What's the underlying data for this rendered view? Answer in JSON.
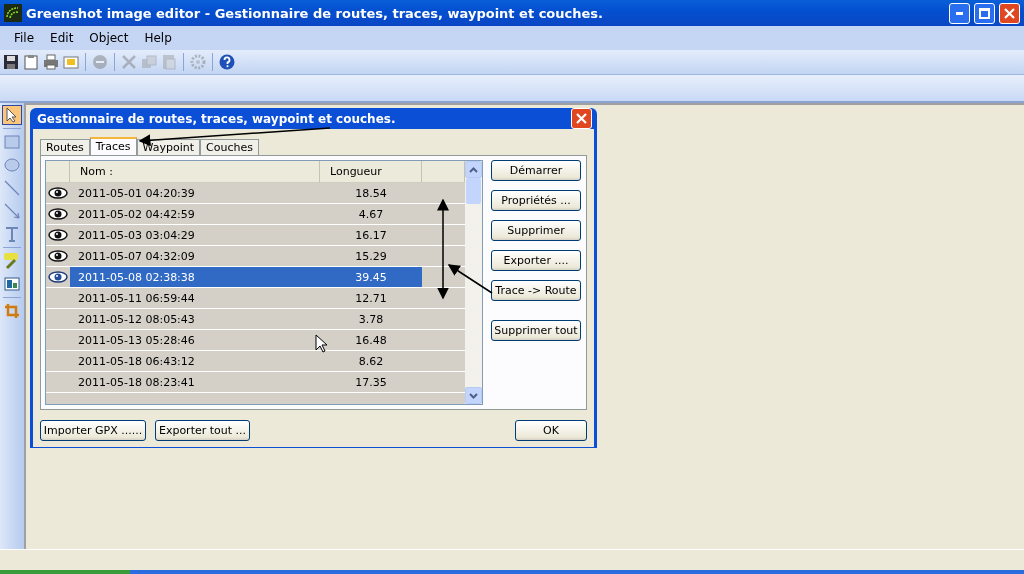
{
  "window": {
    "title": "Greenshot image editor - Gestionnaire de routes, traces, waypoint et couches."
  },
  "menu": [
    "File",
    "Edit",
    "Object",
    "Help"
  ],
  "toolbar": [
    [
      {
        "kind": "save",
        "disabled": false
      },
      {
        "kind": "clipboard",
        "disabled": false
      },
      {
        "kind": "print",
        "disabled": false
      },
      {
        "kind": "email",
        "disabled": false
      }
    ],
    [
      {
        "kind": "delete",
        "disabled": true
      }
    ],
    [
      {
        "kind": "cut",
        "disabled": true
      },
      {
        "kind": "copy",
        "disabled": true
      },
      {
        "kind": "paste",
        "disabled": true
      }
    ],
    [
      {
        "kind": "settings",
        "disabled": true
      }
    ],
    [
      {
        "kind": "help",
        "disabled": false
      }
    ]
  ],
  "tools": [
    [
      {
        "kind": "pointer",
        "selected": true
      }
    ],
    [
      {
        "kind": "rectangle",
        "selected": false
      },
      {
        "kind": "ellipse",
        "selected": false
      },
      {
        "kind": "line",
        "selected": false
      },
      {
        "kind": "arrow",
        "selected": false
      },
      {
        "kind": "text",
        "selected": false
      }
    ],
    [
      {
        "kind": "highlight",
        "selected": false
      },
      {
        "kind": "obfuscate",
        "selected": false
      }
    ],
    [
      {
        "kind": "crop",
        "selected": false
      }
    ]
  ],
  "dialog": {
    "title": "Gestionnaire de routes, traces, waypoint et couches.",
    "tabs": [
      {
        "label": "Routes",
        "selected": false
      },
      {
        "label": "Traces",
        "selected": true
      },
      {
        "label": "Waypoint",
        "selected": false
      },
      {
        "label": "Couches",
        "selected": false
      }
    ],
    "columns": [
      "Nom :",
      "Longueur"
    ],
    "rows": [
      {
        "name": "2011-05-01 04:20:39",
        "length": "18.54",
        "visible": true,
        "selected": false
      },
      {
        "name": "2011-05-02 04:42:59",
        "length": "4.67",
        "visible": true,
        "selected": false
      },
      {
        "name": "2011-05-03 03:04:29",
        "length": "16.17",
        "visible": true,
        "selected": false
      },
      {
        "name": "2011-05-07 04:32:09",
        "length": "15.29",
        "visible": true,
        "selected": false
      },
      {
        "name": "2011-05-08 02:38:38",
        "length": "39.45",
        "visible": true,
        "selected": true
      },
      {
        "name": "2011-05-11 06:59:44",
        "length": "12.71",
        "visible": false,
        "selected": false
      },
      {
        "name": "2011-05-12 08:05:43",
        "length": "3.78",
        "visible": false,
        "selected": false
      },
      {
        "name": "2011-05-13 05:28:46",
        "length": "16.48",
        "visible": false,
        "selected": false
      },
      {
        "name": "2011-05-18 06:43:12",
        "length": "8.62",
        "visible": false,
        "selected": false
      },
      {
        "name": "2011-05-18 08:23:41",
        "length": "17.35",
        "visible": false,
        "selected": false
      }
    ],
    "side_buttons": [
      {
        "label": "Démarrer",
        "kind": "normal"
      },
      {
        "label": "Propriétés ...",
        "kind": "normal"
      },
      {
        "label": "Supprimer",
        "kind": "normal"
      },
      {
        "label": "Exporter ....",
        "kind": "normal"
      },
      {
        "label": "Trace -> Route",
        "kind": "normal"
      },
      {
        "label": "Supprimer tout",
        "kind": "spaced"
      }
    ],
    "bottom_buttons": [
      "Importer GPX ......",
      "Exporter tout ..."
    ],
    "ok": "OK"
  }
}
